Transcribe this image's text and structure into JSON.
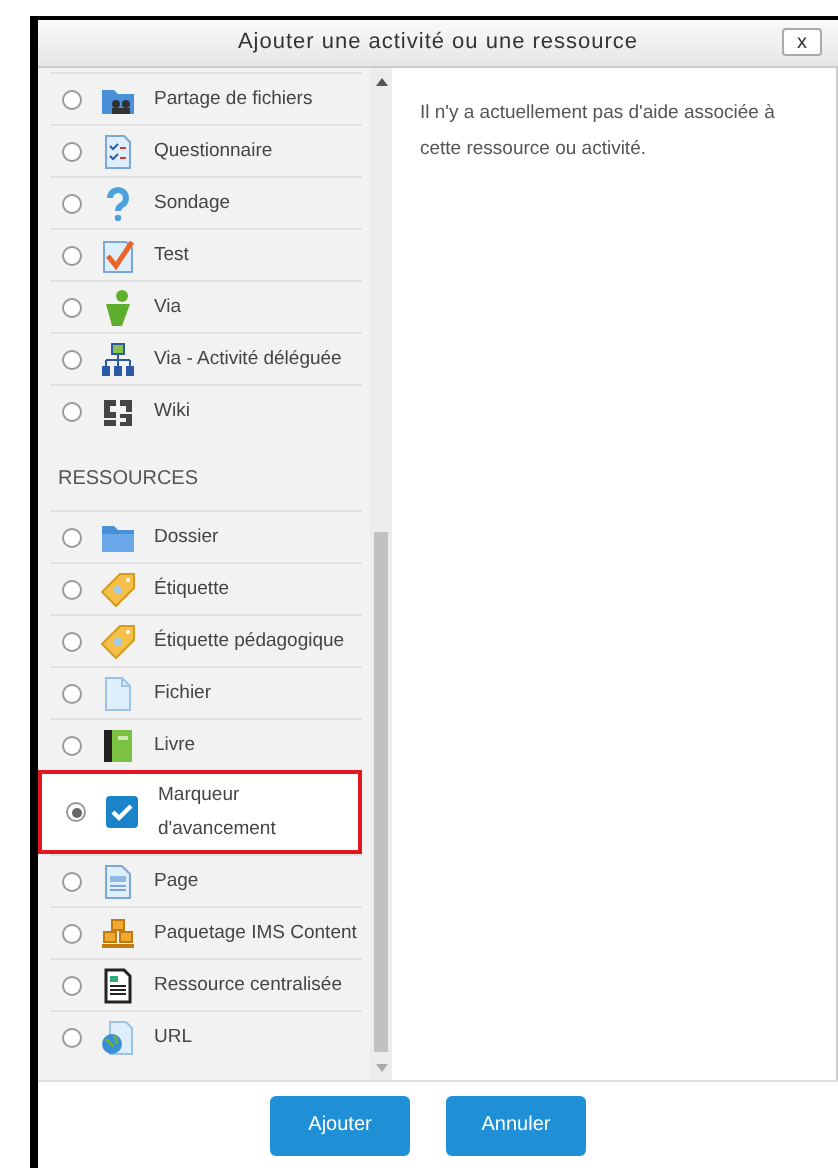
{
  "dialog": {
    "title": "Ajouter une activité ou une ressource",
    "close": "x"
  },
  "sections": [
    {
      "items": [
        {
          "label": "Partage de fichiers",
          "selected": false
        },
        {
          "label": "Questionnaire",
          "selected": false
        },
        {
          "label": "Sondage",
          "selected": false
        },
        {
          "label": "Test",
          "selected": false
        },
        {
          "label": "Via",
          "selected": false
        },
        {
          "label": "Via - Activité déléguée",
          "selected": false
        },
        {
          "label": "Wiki",
          "selected": false
        }
      ]
    },
    {
      "title": "RESSOURCES",
      "items": [
        {
          "label": "Dossier",
          "selected": false
        },
        {
          "label": "Étiquette",
          "selected": false
        },
        {
          "label": "Étiquette pédagogique",
          "selected": false
        },
        {
          "label": "Fichier",
          "selected": false
        },
        {
          "label": "Livre",
          "selected": false
        },
        {
          "label": "Marqueur d'avancement",
          "selected": true
        },
        {
          "label": "Page",
          "selected": false
        },
        {
          "label": "Paquetage IMS Content",
          "selected": false
        },
        {
          "label": "Ressource centralisée",
          "selected": false
        },
        {
          "label": "URL",
          "selected": false
        }
      ]
    }
  ],
  "help_text": "Il n'y a actuellement pas d'aide associée à cette ressource ou activité.",
  "buttons": [
    "Ajouter",
    "Annuler"
  ]
}
